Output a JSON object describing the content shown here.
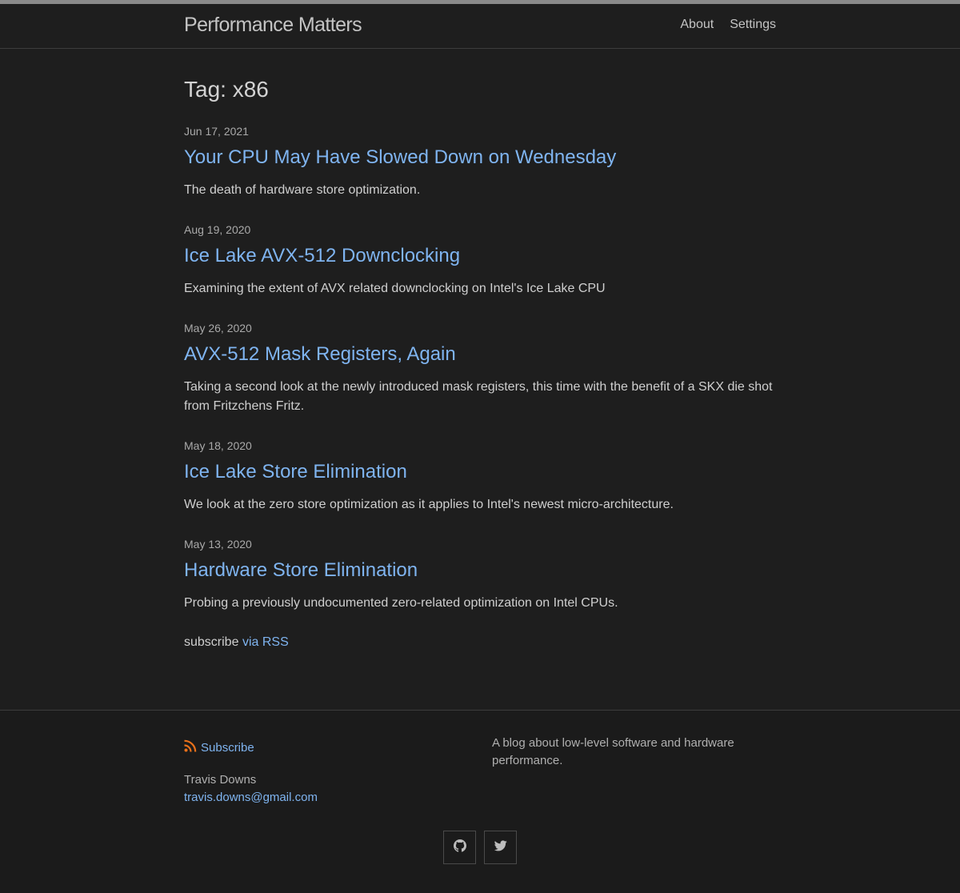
{
  "header": {
    "site_title": "Performance Matters",
    "nav": [
      "About",
      "Settings"
    ]
  },
  "main": {
    "page_heading": "Tag: x86",
    "posts": [
      {
        "date": "Jun 17, 2021",
        "title": "Your CPU May Have Slowed Down on Wednesday",
        "excerpt": "The death of hardware store optimization."
      },
      {
        "date": "Aug 19, 2020",
        "title": "Ice Lake AVX-512 Downclocking",
        "excerpt": "Examining the extent of AVX related downclocking on Intel's Ice Lake CPU"
      },
      {
        "date": "May 26, 2020",
        "title": "AVX-512 Mask Registers, Again",
        "excerpt": "Taking a second look at the newly introduced mask registers, this time with the benefit of a SKX die shot from Fritzchens Fritz."
      },
      {
        "date": "May 18, 2020",
        "title": "Ice Lake Store Elimination",
        "excerpt": "We look at the zero store optimization as it applies to Intel's newest micro-architecture."
      },
      {
        "date": "May 13, 2020",
        "title": "Hardware Store Elimination",
        "excerpt": "Probing a previously undocumented zero-related optimization on Intel CPUs."
      }
    ],
    "rss_prefix": "subscribe",
    "rss_link": "via RSS"
  },
  "footer": {
    "subscribe_label": "Subscribe",
    "author": "Travis Downs",
    "email": "travis.downs@gmail.com",
    "description": "A blog about low-level software and hardware performance.",
    "social": [
      "github-icon",
      "twitter-icon"
    ]
  },
  "colors": {
    "background": "#1e1e1e",
    "link": "#7fb4f0",
    "rss_icon": "#e8701a"
  }
}
